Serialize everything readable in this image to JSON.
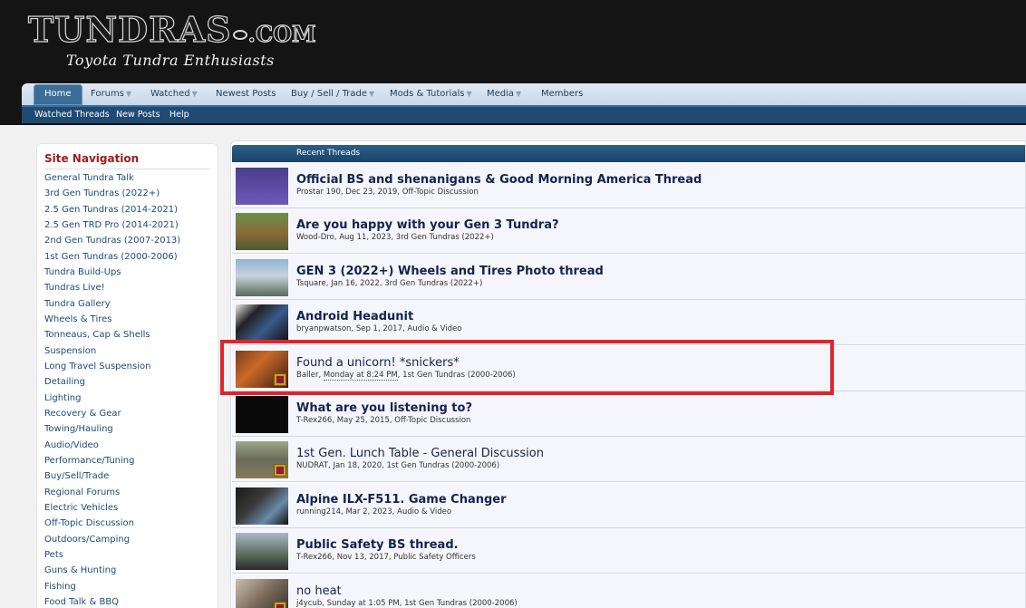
{
  "header": {
    "logo_main": "TUNDRAS",
    "logo_suffix": "COM",
    "tagline": "Toyota Tundra Enthusiasts"
  },
  "nav": {
    "home": "Home",
    "forums": "Forums",
    "watched": "Watched",
    "newest_posts": "Newest Posts",
    "buy_sell_trade": "Buy / Sell / Trade",
    "mods_tutorials": "Mods & Tutorials",
    "media": "Media",
    "members": "Members",
    "dropdown_arrow": "▼"
  },
  "subnav": {
    "watched_threads": "Watched Threads",
    "new_posts": "New Posts",
    "help": "Help"
  },
  "sidebar": {
    "title": "Site Navigation",
    "items": [
      "General Tundra Talk",
      "3rd Gen Tundras (2022+)",
      "2.5 Gen Tundras (2014-2021)",
      "2.5 Gen TRD Pro (2014-2021)",
      "2nd Gen Tundras (2007-2013)",
      "1st Gen Tundras (2000-2006)",
      "Tundra Build-Ups",
      "Tundras Live!",
      "Tundra Gallery",
      "Wheels & Tires",
      "Tonneaus, Cap & Shells",
      "Suspension",
      "Long Travel Suspension",
      "Detailing",
      "Lighting",
      "Recovery & Gear",
      "Towing/Hauling",
      "Audio/Video",
      "Performance/Tuning",
      "Buy/Sell/Trade",
      "Regional Forums",
      "Electric Vehicles",
      "Off-Topic Discussion",
      "Outdoors/Camping",
      "Pets",
      "Guns & Hunting",
      "Fishing",
      "Food Talk & BBQ"
    ]
  },
  "recent": {
    "header": "Recent Threads",
    "threads": [
      {
        "title": "Official BS and shenanigans & Good Morning America Thread",
        "author": "Prostar 190",
        "date": "Dec 23, 2019",
        "forum": "Off-Topic Discussion",
        "bold": true
      },
      {
        "title": "Are you happy with your Gen 3 Tundra?",
        "author": "Wood-Dro",
        "date": "Aug 11, 2023",
        "forum": "3rd Gen Tundras (2022+)",
        "bold": true
      },
      {
        "title": "GEN 3 (2022+) Wheels and Tires Photo thread",
        "author": "Tsquare",
        "date": "Jan 16, 2022",
        "forum": "3rd Gen Tundras (2022+)",
        "bold": true
      },
      {
        "title": "Android Headunit",
        "author": "bryanpwatson",
        "date": "Sep 1, 2017",
        "forum": "Audio & Video",
        "bold": true
      },
      {
        "title": "Found a unicorn! *snickers*",
        "author": "Baller",
        "date": "Monday at 8:24 PM",
        "forum": "1st Gen Tundras (2000-2006)",
        "bold": false
      },
      {
        "title": "What are you listening to?",
        "author": "T-Rex266",
        "date": "May 25, 2015",
        "forum": "Off-Topic Discussion",
        "bold": true
      },
      {
        "title": "1st Gen. Lunch Table - General Discussion",
        "author": "NUDRAT",
        "date": "Jan 18, 2020",
        "forum": "1st Gen Tundras (2000-2006)",
        "bold": false
      },
      {
        "title": "Alpine ILX-F511. Game Changer",
        "author": "running214",
        "date": "Mar 2, 2023",
        "forum": "Audio & Video",
        "bold": true
      },
      {
        "title": "Public Safety BS thread.",
        "author": "T-Rex266",
        "date": "Nov 13, 2017",
        "forum": "Public Safety Officers",
        "bold": true
      },
      {
        "title": "no heat",
        "author": "j4ycub",
        "date": "Sunday at 1:05 PM",
        "forum": "1st Gen Tundras (2000-2006)",
        "bold": false
      }
    ]
  },
  "colors": {
    "highlight": "#e0242b",
    "nav_blue": "#1f4b73",
    "sidebar_title": "#a01c1c"
  }
}
